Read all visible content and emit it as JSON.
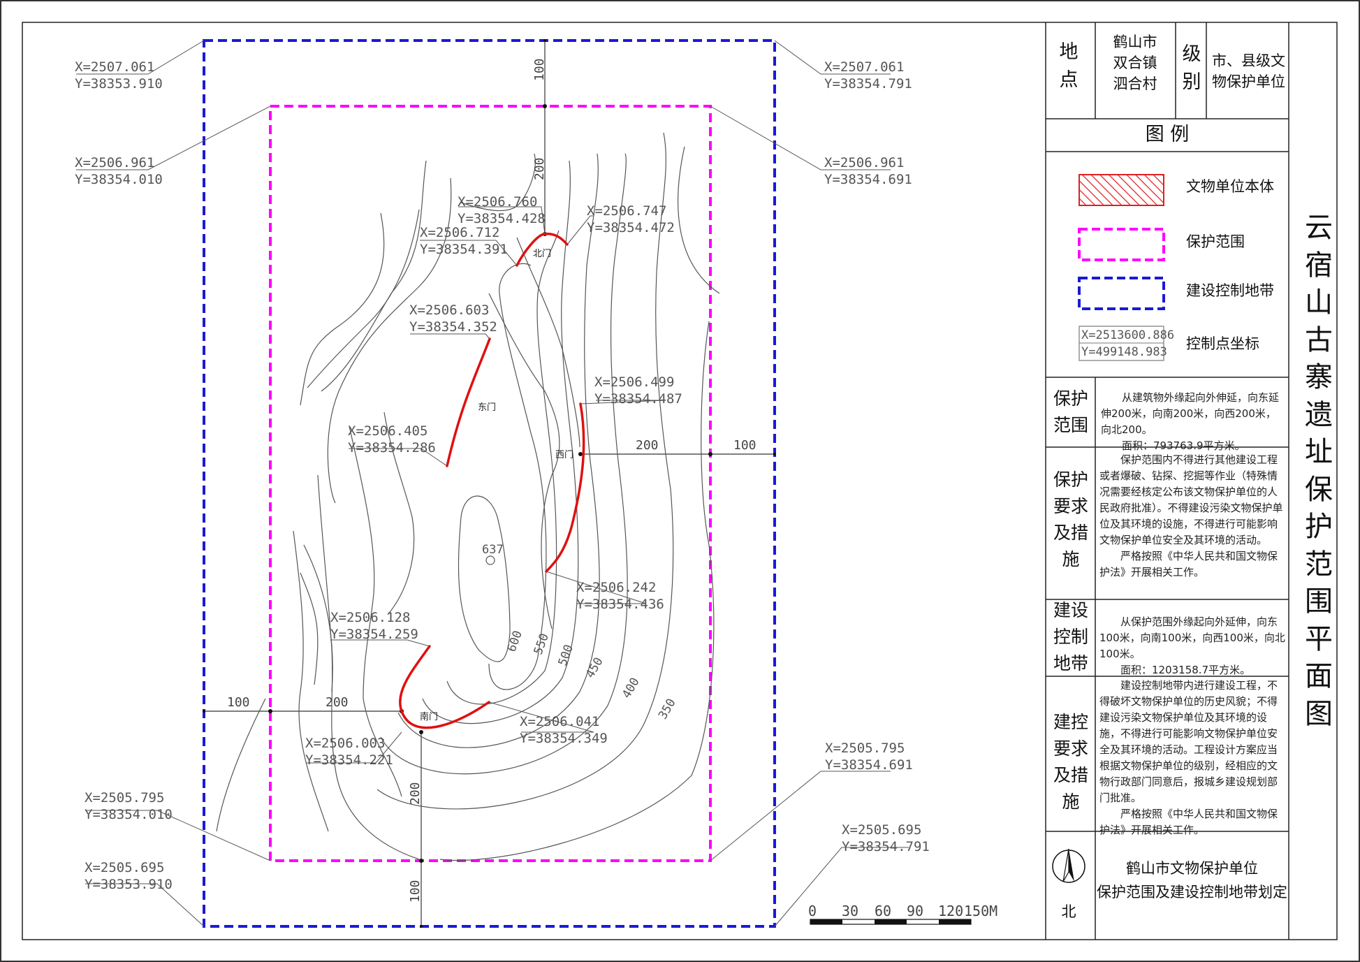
{
  "title": "云宿山古寨遗址保护范围平面图",
  "info": {
    "location_label": "地点",
    "location_value": "鹤山市双合镇泗合村",
    "level_label": "级别",
    "level_value": "市、县级文物保护单位"
  },
  "legend": {
    "heading": "图 例",
    "items": [
      {
        "label": "文物单位本体",
        "color": "#e02020",
        "icon": "hatched-red-box-icon"
      },
      {
        "label": "保护范围",
        "color": "#ff00ff",
        "icon": "magenta-dashed-box-icon"
      },
      {
        "label": "建设控制地带",
        "color": "#1a1ad6",
        "icon": "blue-dashed-box-icon"
      },
      {
        "label": "控制点坐标",
        "icon": "coordinate-box-icon",
        "sample_x": "X=2513600.886",
        "sample_y": "Y=499148.983"
      }
    ]
  },
  "sections": [
    {
      "label": "保护范围",
      "text": [
        "从建筑物外缘起向外伸延，向东延伸200米，向南200米，向西200米，向北200。",
        "面积：793763.9平方米。"
      ]
    },
    {
      "label": "保护要求及措施",
      "text": [
        "保护范围内不得进行其他建设工程或者爆破、钻探、挖掘等作业（特殊情况需要经核定公布该文物保护单位的人民政府批准）。不得建设污染文物保护单位及其环境的设施，不得进行可能影响文物保护单位安全及其环境的活动。",
        "严格按照《中华人民共和国文物保护法》开展相关工作。"
      ]
    },
    {
      "label": "建设控制地带",
      "text": [
        "从保护范围外缘起向外延伸，向东100米，向南100米，向西100米，向北100米。",
        "面积：1203158.7平方米。"
      ]
    },
    {
      "label": "建控要求及措施",
      "text": [
        "建设控制地带内进行建设工程，不得破坏文物保护单位的历史风貌；不得建设污染文物保护单位及其环境的设施，不得进行可能影响文物保护单位安全及其环境的活动。工程设计方案应当根据文物保护单位的级别，经相应的文物行政部门同意后，报城乡建设规划部门批准。",
        "严格按照《中华人民共和国文物保护法》开展相关工作。"
      ]
    }
  ],
  "footer": {
    "north_label": "北",
    "org_line1": "鹤山市文物保护单位",
    "org_line2": "保护范围及建设控制地带划定"
  },
  "map": {
    "coordinates": [
      {
        "id": "c1",
        "x": "X=2507.061",
        "y": "Y=38353.910"
      },
      {
        "id": "c2",
        "x": "X=2507.061",
        "y": "Y=38354.791"
      },
      {
        "id": "c3",
        "x": "X=2506.961",
        "y": "Y=38354.010"
      },
      {
        "id": "c4",
        "x": "X=2506.961",
        "y": "Y=38354.691"
      },
      {
        "id": "c5",
        "x": "X=2506.760",
        "y": "Y=38354.428"
      },
      {
        "id": "c6",
        "x": "X=2506.747",
        "y": "Y=38354.472"
      },
      {
        "id": "c7",
        "x": "X=2506.712",
        "y": "Y=38354.391"
      },
      {
        "id": "c8",
        "x": "X=2506.603",
        "y": "Y=38354.352"
      },
      {
        "id": "c9",
        "x": "X=2506.499",
        "y": "Y=38354.487"
      },
      {
        "id": "c10",
        "x": "X=2506.405",
        "y": "Y=38354.286"
      },
      {
        "id": "c11",
        "x": "X=2506.242",
        "y": "Y=38354.436"
      },
      {
        "id": "c12",
        "x": "X=2506.128",
        "y": "Y=38354.259"
      },
      {
        "id": "c13",
        "x": "X=2506.041",
        "y": "Y=38354.349"
      },
      {
        "id": "c14",
        "x": "X=2506.003",
        "y": "Y=38354.221"
      },
      {
        "id": "c15",
        "x": "X=2505.795",
        "y": "Y=38354.691"
      },
      {
        "id": "c16",
        "x": "X=2505.795",
        "y": "Y=38354.010"
      },
      {
        "id": "c17",
        "x": "X=2505.695",
        "y": "Y=38354.791"
      },
      {
        "id": "c18",
        "x": "X=2505.695",
        "y": "Y=38353.910"
      }
    ],
    "gates": {
      "north": "北门",
      "east": "东门",
      "west": "西门",
      "south": "南门"
    },
    "peak_elevation": "637",
    "contours": [
      "600",
      "550",
      "500",
      "450",
      "400",
      "350"
    ],
    "dimensions": {
      "north_outer": "100",
      "north_inner": "200",
      "east_inner": "200",
      "east_outer": "100",
      "west_outer": "100",
      "west_inner": "200",
      "south_inner": "200",
      "south_outer": "100"
    },
    "scale": {
      "ticks": [
        "0",
        "30",
        "60",
        "90",
        "120"
      ],
      "last": "150M"
    }
  }
}
